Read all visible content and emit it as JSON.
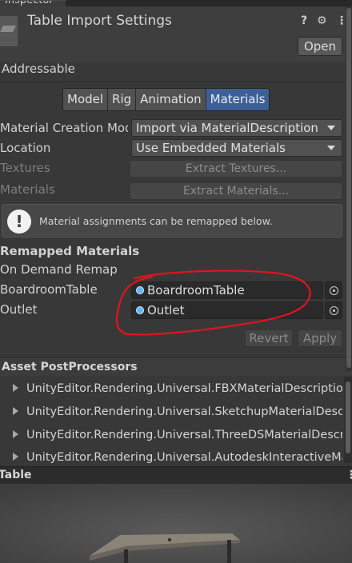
{
  "window": {
    "tab_label": "Inspector"
  },
  "header": {
    "title": "Table Import Settings",
    "open_label": "Open",
    "help_glyph": "?",
    "settings_glyph": "⚙",
    "menu_glyph": "⋮"
  },
  "addressable_label": "Addressable",
  "tabs": [
    {
      "label": "Model"
    },
    {
      "label": "Rig"
    },
    {
      "label": "Animation"
    },
    {
      "label": "Materials",
      "active": true
    }
  ],
  "materials": {
    "creation_mode": {
      "label": "Material Creation Mode",
      "value": "Import via MaterialDescription"
    },
    "location": {
      "label": "Location",
      "value": "Use Embedded Materials"
    },
    "textures": {
      "label": "Textures",
      "button": "Extract Textures..."
    },
    "materials_row": {
      "label": "Materials",
      "button": "Extract Materials..."
    },
    "help_icon": "!",
    "help_text": "Material assignments can be remapped below.",
    "remapped_header": "Remapped Materials",
    "on_demand_label": "On Demand Remap",
    "remaps": [
      {
        "label": "BoardroomTable",
        "value": "BoardroomTable"
      },
      {
        "label": "Outlet",
        "value": "Outlet"
      }
    ],
    "revert_label": "Revert",
    "apply_label": "Apply"
  },
  "postprocessors": {
    "header": "Asset PostProcessors",
    "items": [
      "UnityEditor.Rendering.Universal.FBXMaterialDescriptionPostprocessor",
      "UnityEditor.Rendering.Universal.SketchupMaterialDescriptionPreprocessor",
      "UnityEditor.Rendering.Universal.ThreeDSMaterialDescriptionPreprocessor",
      "UnityEditor.Rendering.Universal.AutodeskInteractiveMaterialImport"
    ]
  },
  "preview": {
    "header": "Table",
    "menu_glyph": "⋮"
  },
  "colors": {
    "annotation_red": "#e0141e",
    "active_tab": "#3e5f96",
    "object_dot": "#5fb8f0"
  }
}
